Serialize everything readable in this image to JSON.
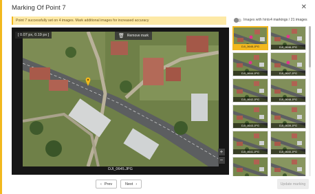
{
  "dialog": {
    "title": "Marking Of Point 7",
    "close_label": "✕",
    "banner": "Point 7 successfully set on 4 images. Mark additional images for increased accuracy",
    "toggle_label": "Images with hints",
    "counts": "4 markings / 21 images"
  },
  "viewer": {
    "coordinates": "[ 0.07 px, 0.19 px ]",
    "remove_mark_label": "Remove mark",
    "zoom_in": "+",
    "zoom_out": "−",
    "filename": "DJI_0645.JPG"
  },
  "navigation": {
    "prev_label": "Prev",
    "next_label": "Next",
    "update_label": "Update marking"
  },
  "thumbnails": [
    {
      "label": "DJI_0645.JPG",
      "selected": true,
      "marked": true
    },
    {
      "label": "DJI_0646.JPG",
      "selected": false,
      "marked": true
    },
    {
      "label": "DJI_0644.JPG",
      "selected": false,
      "marked": true
    },
    {
      "label": "DJI_0647.JPG",
      "selected": false,
      "marked": true
    },
    {
      "label": "DJI_0642.JPG",
      "selected": false,
      "marked": false
    },
    {
      "label": "DJI_0648.JPG",
      "selected": false,
      "marked": false
    },
    {
      "label": "DJI_0643.JPG",
      "selected": false,
      "marked": false
    },
    {
      "label": "DJI_0639.JPG",
      "selected": false,
      "marked": false
    },
    {
      "label": "DJI_0641.JPG",
      "selected": false,
      "marked": false
    },
    {
      "label": "DJI_0640.JPG",
      "selected": false,
      "marked": false
    },
    {
      "label": "",
      "selected": false,
      "marked": false
    },
    {
      "label": "",
      "selected": false,
      "marked": false
    }
  ],
  "colors": {
    "accent": "#f2b81e",
    "banner_bg": "#fde9a6",
    "viewer_bg": "#161616"
  }
}
